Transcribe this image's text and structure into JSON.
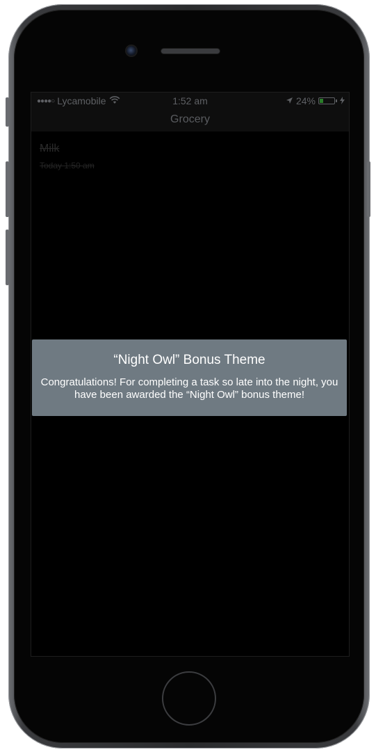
{
  "status_bar": {
    "signal": "●●●●○",
    "carrier": "Lycamobile",
    "wifi_icon": "wifi-icon",
    "time": "1:52 am",
    "location_icon": "location-arrow-icon",
    "battery_percent": "24%",
    "battery_level": 0.24,
    "charging_icon": "charging-bolt-icon"
  },
  "nav": {
    "title": "Grocery"
  },
  "tasks": [
    {
      "title": "Milk",
      "time": "Today 1:50 am",
      "completed": true
    }
  ],
  "alert": {
    "title": "“Night Owl” Bonus Theme",
    "message": "Congratulations! For completing a task so late into the night, you have been awarded the “Night Owl” bonus theme!"
  },
  "colors": {
    "alert_background": "#6f7a82",
    "screen_background": "#000000",
    "battery_fill": "#2a7d2a"
  }
}
